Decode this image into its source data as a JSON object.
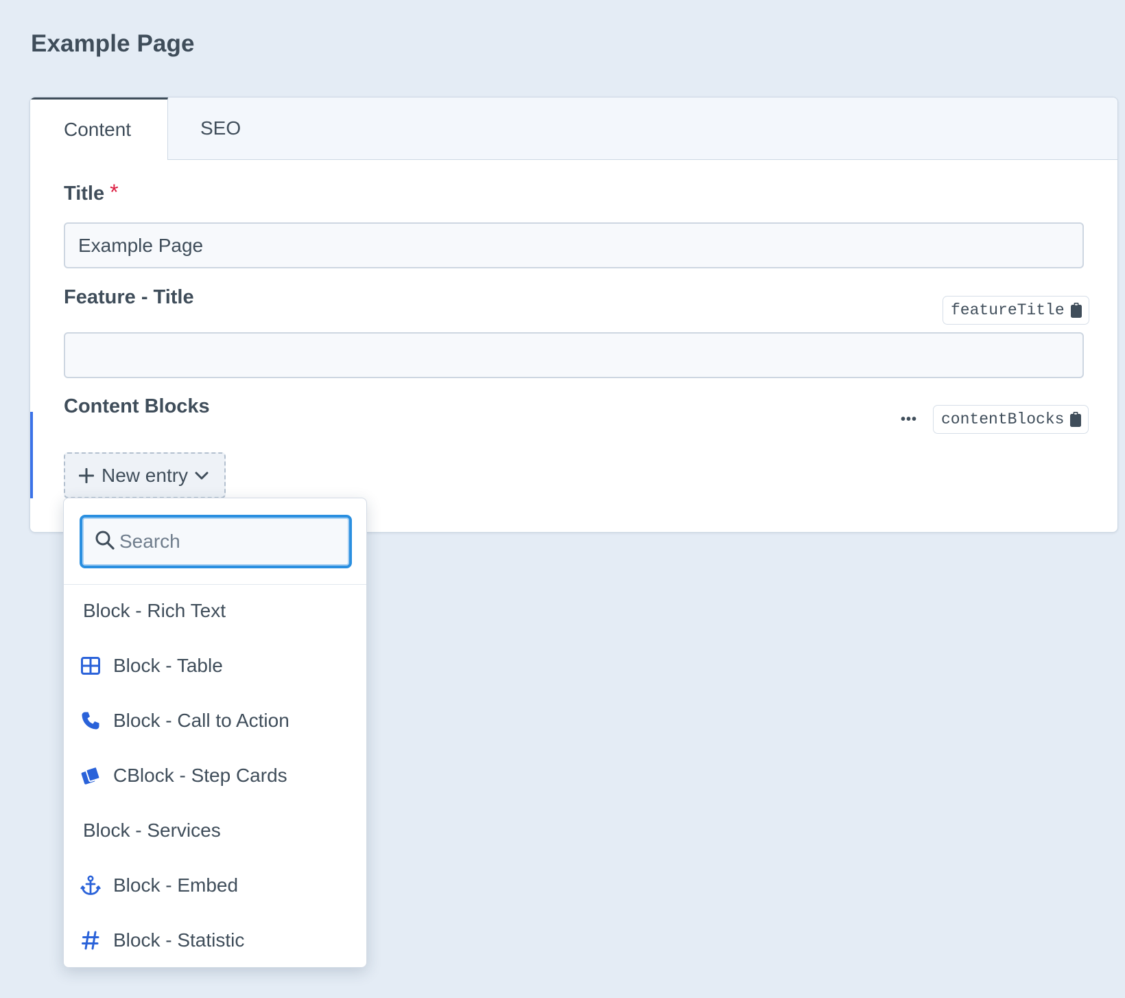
{
  "page": {
    "title": "Example Page"
  },
  "tabs": [
    {
      "label": "Content",
      "selected": true
    },
    {
      "label": "SEO",
      "selected": false
    }
  ],
  "fields": {
    "title": {
      "label": "Title",
      "required_marker": "*",
      "value": "Example Page"
    },
    "feature_title": {
      "label": "Feature - Title",
      "handle": "featureTitle",
      "value": ""
    },
    "content_blocks": {
      "label": "Content Blocks",
      "handle": "contentBlocks",
      "more_label": "•••",
      "new_entry_label": "New entry"
    }
  },
  "menu": {
    "search_placeholder": "Search",
    "items": [
      {
        "label": "Block - Rich Text",
        "icon": ""
      },
      {
        "label": "Block - Table",
        "icon": "table-icon"
      },
      {
        "label": "Block - Call to Action",
        "icon": "phone-icon"
      },
      {
        "label": "CBlock - Step Cards",
        "icon": "cards-icon"
      },
      {
        "label": "Block - Services",
        "icon": ""
      },
      {
        "label": "Block - Embed",
        "icon": "anchor-icon"
      },
      {
        "label": "Block - Statistic",
        "icon": "hashtag-icon"
      }
    ]
  },
  "colors": {
    "background": "#e4ecf5",
    "text": "#3f4d5a",
    "accent": "#3b72e8",
    "focus_ring": "#2a8fe0",
    "required": "#dc1d41",
    "icon_blue": "#2a62d9"
  }
}
